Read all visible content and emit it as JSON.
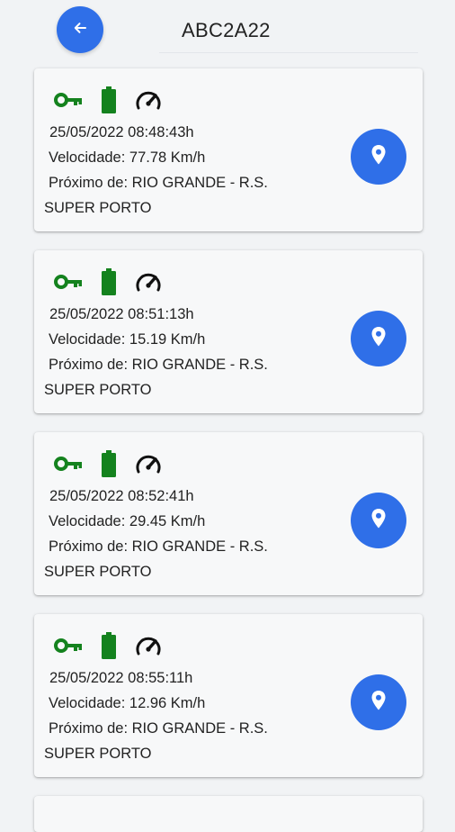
{
  "header": {
    "title": "ABC2A22",
    "back_icon": "arrow-left-icon"
  },
  "colors": {
    "accent": "#2f6fe8",
    "status_green": "#14821e"
  },
  "records": [
    {
      "icons": [
        "key-icon",
        "battery-icon",
        "speedometer-icon"
      ],
      "datetime": "25/05/2022 08:48:43h",
      "speed": "Velocidade: 77.78 Km/h",
      "near": "Próximo de: RIO GRANDE - R.S.",
      "place": "SUPER PORTO",
      "map_icon": "map-pin-icon"
    },
    {
      "icons": [
        "key-icon",
        "battery-icon",
        "speedometer-icon"
      ],
      "datetime": "25/05/2022 08:51:13h",
      "speed": "Velocidade: 15.19 Km/h",
      "near": "Próximo de: RIO GRANDE - R.S.",
      "place": "SUPER PORTO",
      "map_icon": "map-pin-icon"
    },
    {
      "icons": [
        "key-icon",
        "battery-icon",
        "speedometer-icon"
      ],
      "datetime": "25/05/2022 08:52:41h",
      "speed": "Velocidade: 29.45 Km/h",
      "near": "Próximo de: RIO GRANDE - R.S.",
      "place": "SUPER PORTO",
      "map_icon": "map-pin-icon"
    },
    {
      "icons": [
        "key-icon",
        "battery-icon",
        "speedometer-icon"
      ],
      "datetime": "25/05/2022 08:55:11h",
      "speed": "Velocidade: 12.96 Km/h",
      "near": "Próximo de: RIO GRANDE - R.S.",
      "place": "SUPER PORTO",
      "map_icon": "map-pin-icon"
    }
  ]
}
